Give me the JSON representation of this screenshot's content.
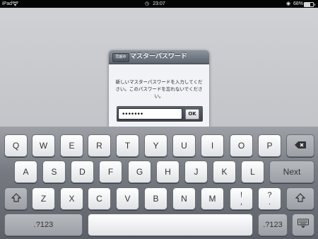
{
  "status": {
    "device": "iPad",
    "time": "23:07",
    "battery": "68%",
    "battery_level": 0.68
  },
  "dialog": {
    "cancel_label": "同期中",
    "title": "マスターパスワード",
    "message": "新しいマスターパスワードを入力してください。このパスワードを忘れないでください。",
    "password_value": "•••••••",
    "ok_label": "OK"
  },
  "keyboard": {
    "row1": [
      "Q",
      "W",
      "E",
      "R",
      "T",
      "Y",
      "U",
      "I",
      "O",
      "P"
    ],
    "row2": [
      "A",
      "S",
      "D",
      "F",
      "G",
      "H",
      "J",
      "K",
      "L"
    ],
    "next_label": "Next",
    "row3": [
      "Z",
      "X",
      "C",
      "V",
      "B",
      "N",
      "M"
    ],
    "exclaim": "!\n,",
    "question": "?\n.",
    "numbers_label": ".?123",
    "numbers_label_right": ".?123"
  },
  "icons": {
    "wifi": "wifi-icon",
    "backspace": "backspace-icon",
    "shift": "shift-icon",
    "dismiss": "keyboard-dismiss-icon"
  }
}
